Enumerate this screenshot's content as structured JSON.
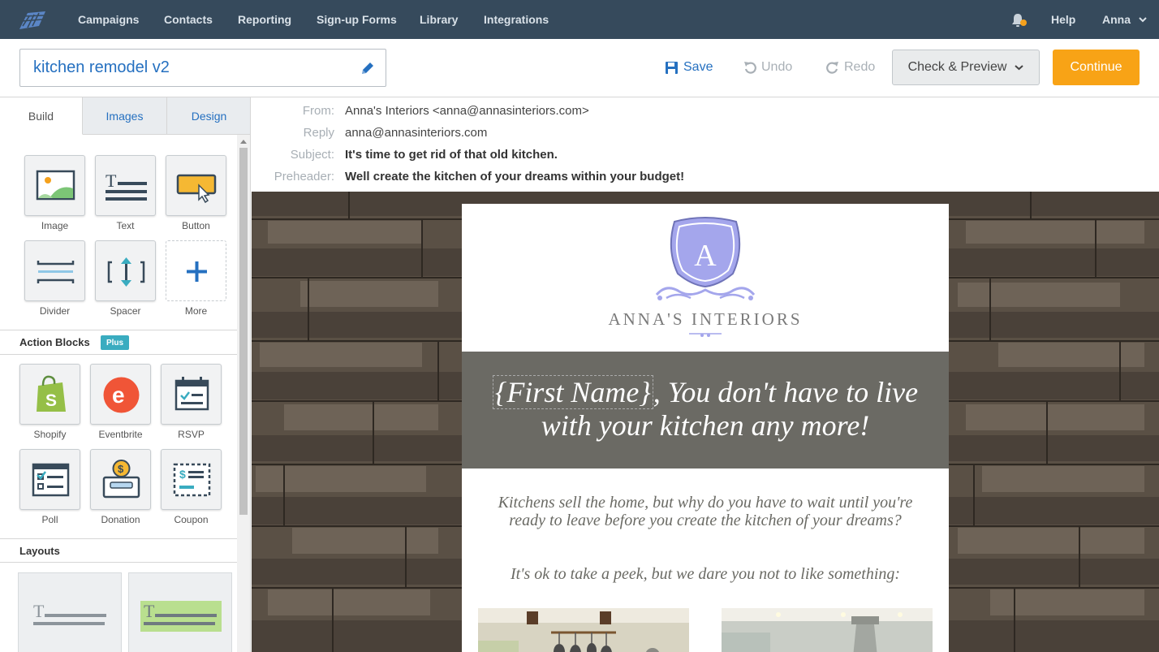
{
  "nav": {
    "items": [
      "Campaigns",
      "Contacts",
      "Reporting",
      "Sign-up Forms",
      "Library",
      "Integrations"
    ],
    "help": "Help",
    "user": "Anna",
    "colors": {
      "bg": "#364a5c",
      "notification_dot": "#f5a11d"
    }
  },
  "toolbar": {
    "campaign_name": "kitchen remodel v2",
    "save_label": "Save",
    "undo_label": "Undo",
    "redo_label": "Redo",
    "check_label": "Check & Preview",
    "continue_label": "Continue",
    "colors": {
      "continue": "#f8a316",
      "link": "#2570c0"
    }
  },
  "sidebar": {
    "tabs": [
      "Build",
      "Images",
      "Design"
    ],
    "active_tab": "Build",
    "blocks": [
      {
        "label": "Image",
        "icon": "image-icon"
      },
      {
        "label": "Text",
        "icon": "text-icon"
      },
      {
        "label": "Button",
        "icon": "button-icon"
      },
      {
        "label": "Divider",
        "icon": "divider-icon"
      },
      {
        "label": "Spacer",
        "icon": "spacer-icon"
      },
      {
        "label": "More",
        "icon": "plus-icon"
      }
    ],
    "action_blocks_title": "Action Blocks",
    "plus_badge": "Plus",
    "action_blocks": [
      {
        "label": "Shopify",
        "icon": "shopify-icon"
      },
      {
        "label": "Eventbrite",
        "icon": "eventbrite-icon"
      },
      {
        "label": "RSVP",
        "icon": "calendar-icon"
      },
      {
        "label": "Poll",
        "icon": "poll-icon"
      },
      {
        "label": "Donation",
        "icon": "donation-icon"
      },
      {
        "label": "Coupon",
        "icon": "coupon-icon"
      }
    ],
    "layouts_title": "Layouts"
  },
  "email_meta": {
    "from_label": "From:",
    "from_value": "Anna's Interiors <anna@annasinteriors.com>",
    "reply_label": "Reply",
    "reply_value": "anna@annasinteriors.com",
    "subject_label": "Subject:",
    "subject_value": "It's time to get rid of that old kitchen.",
    "preheader_label": "Preheader:",
    "preheader_value": "Well create the kitchen of your dreams within your budget!"
  },
  "email": {
    "logo_letter": "A",
    "brand_name": "ANNA'S INTERIORS",
    "headline_token": "{First Name}",
    "headline_rest": ", You don't have to live with your kitchen any more!",
    "body_paragraph_1": "Kitchens sell the home, but why do you have to wait until you're ready to leave before you create the kitchen of your dreams?",
    "body_paragraph_2": "It's ok to take a peek, but we dare you not to like something:",
    "colors": {
      "band": "#6b6a64",
      "crest": "#a4a6ec",
      "body_text": "#6a6a64"
    }
  }
}
